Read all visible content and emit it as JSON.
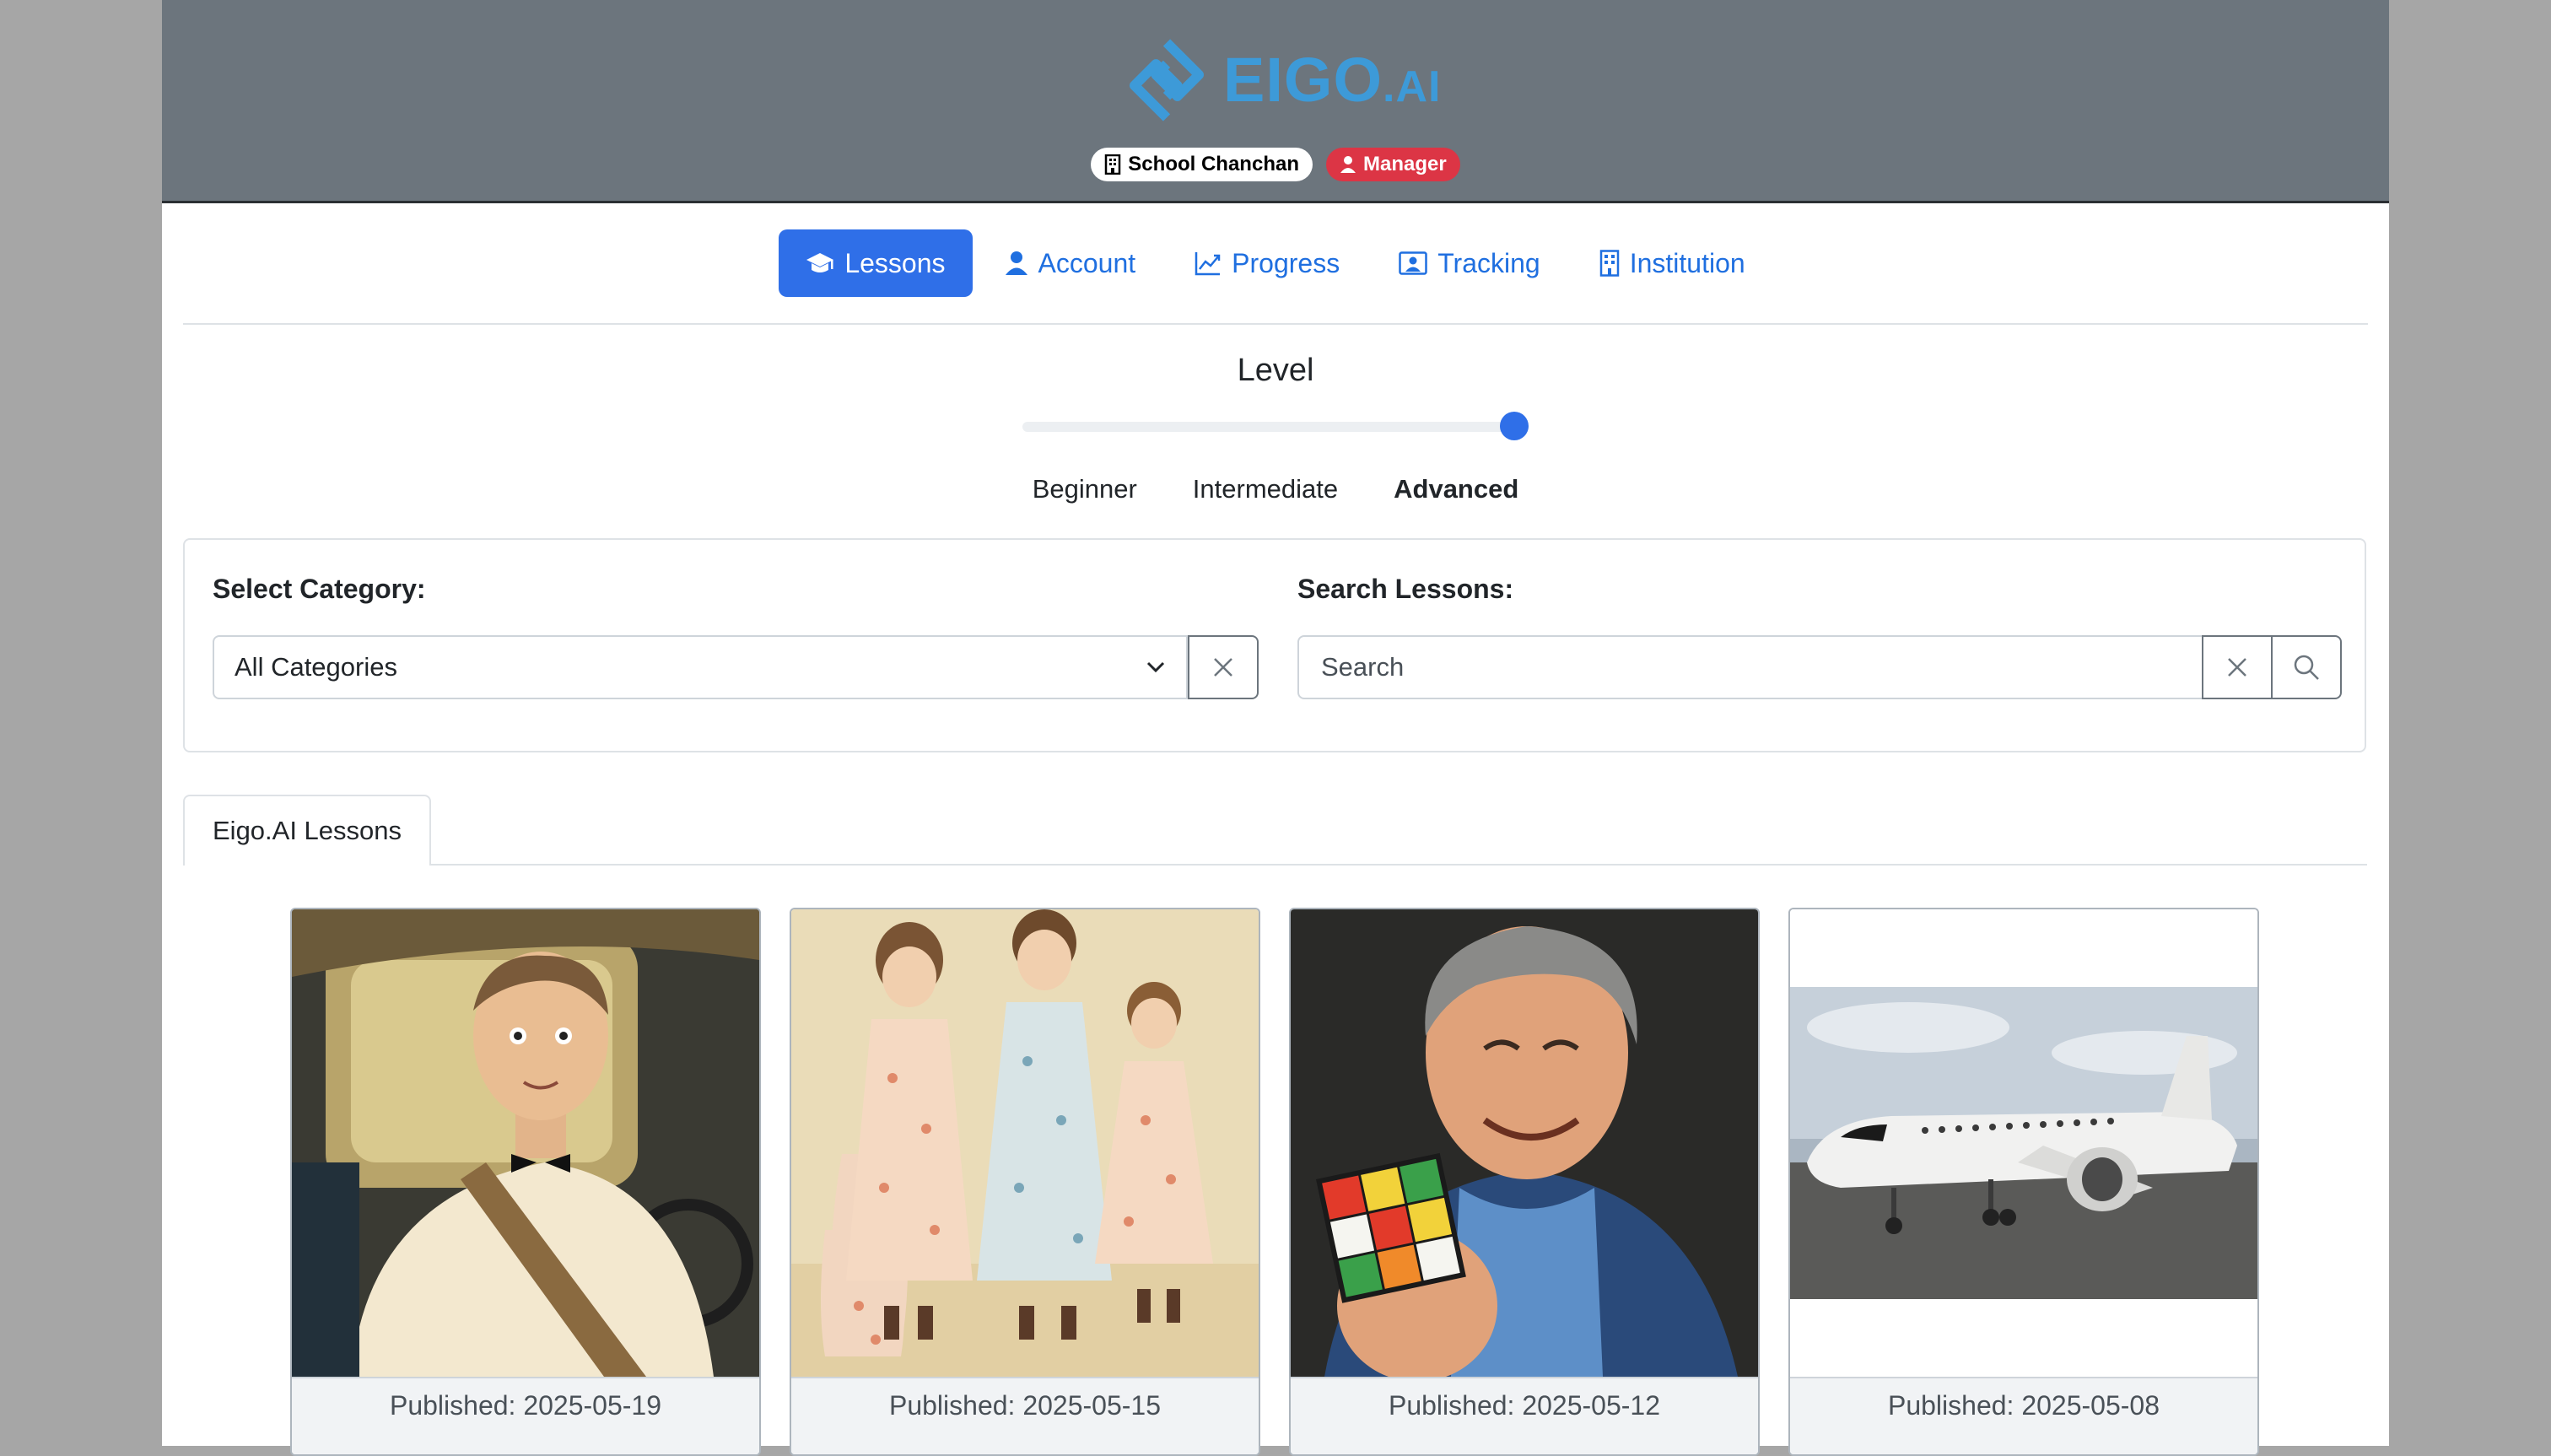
{
  "brand": {
    "logo_text": "EIGO",
    "logo_suffix": ".AI"
  },
  "header": {
    "institution_badge": "School Chanchan",
    "role_badge": "Manager"
  },
  "nav": {
    "items": [
      {
        "label": "Lessons",
        "icon": "graduation-cap-icon",
        "active": true
      },
      {
        "label": "Account",
        "icon": "person-icon",
        "active": false
      },
      {
        "label": "Progress",
        "icon": "chart-line-icon",
        "active": false
      },
      {
        "label": "Tracking",
        "icon": "person-badge-icon",
        "active": false
      },
      {
        "label": "Institution",
        "icon": "building-icon",
        "active": false
      }
    ]
  },
  "level": {
    "title": "Level",
    "options": [
      "Beginner",
      "Intermediate",
      "Advanced"
    ],
    "selected": "Advanced",
    "slider_value_fraction": 1.0
  },
  "filters": {
    "category_label": "Select Category:",
    "category_value": "All Categories",
    "search_label": "Search Lessons:",
    "search_placeholder": "Search"
  },
  "tabs": {
    "active_label": "Eigo.AI Lessons"
  },
  "lessons": [
    {
      "image": "man-driving-vintage-car-illustration",
      "published": "Published: 2025-05-19"
    },
    {
      "image": "three-girls-in-floral-dresses-illustration",
      "published": "Published: 2025-05-15"
    },
    {
      "image": "old-man-holding-rubiks-cube-illustration",
      "published": "Published: 2025-05-12"
    },
    {
      "image": "private-jet-on-tarmac-photo",
      "published": "Published: 2025-05-08"
    }
  ],
  "colors": {
    "header_bg": "#6c757d",
    "brand_blue": "#3d9ad8",
    "primary": "#2f6fe8",
    "danger_badge": "#dc3545"
  }
}
